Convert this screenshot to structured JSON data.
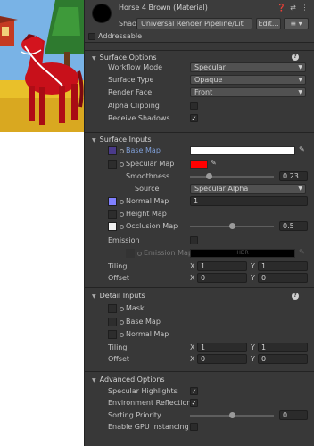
{
  "header": {
    "title": "Horse 4 Brown (Material)",
    "shader_label": "Shader",
    "shader_value": "Universal Render Pipeline/Lit",
    "edit_label": "Edit...",
    "list_label": "≡ ▾",
    "addressable_label": "Addressable"
  },
  "surface_options": {
    "title": "Surface Options",
    "workflow_label": "Workflow Mode",
    "workflow_value": "Specular",
    "surface_type_label": "Surface Type",
    "surface_type_value": "Opaque",
    "render_face_label": "Render Face",
    "render_face_value": "Front",
    "alpha_clipping_label": "Alpha Clipping",
    "receive_shadows_label": "Receive Shadows"
  },
  "surface_inputs": {
    "title": "Surface Inputs",
    "base_map_label": "Base Map",
    "base_map_color": "#ffffff",
    "specular_map_label": "Specular Map",
    "specular_color": "#ff0000",
    "smoothness_label": "Smoothness",
    "smoothness_value": "0.23",
    "smoothness_fraction": 0.23,
    "source_label": "Source",
    "source_value": "Specular Alpha",
    "normal_map_label": "Normal Map",
    "normal_value": "1",
    "height_map_label": "Height Map",
    "occlusion_map_label": "Occlusion Map",
    "occlusion_value": "0.5",
    "occlusion_fraction": 0.5,
    "emission_label": "Emission",
    "emission_map_label": "Emission Map",
    "emission_hdr": "HDR",
    "tiling_label": "Tiling",
    "tiling_x": "1",
    "tiling_y": "1",
    "offset_label": "Offset",
    "offset_x": "0",
    "offset_y": "0",
    "x_label": "X",
    "y_label": "Y"
  },
  "detail_inputs": {
    "title": "Detail Inputs",
    "mask_label": "Mask",
    "base_map_label": "Base Map",
    "normal_map_label": "Normal Map",
    "tiling_label": "Tiling",
    "tiling_x": "1",
    "tiling_y": "1",
    "offset_label": "Offset",
    "offset_x": "0",
    "offset_y": "0",
    "x_label": "X",
    "y_label": "Y"
  },
  "advanced_options": {
    "title": "Advanced Options",
    "specular_highlights_label": "Specular Highlights",
    "env_reflections_label": "Environment Reflections",
    "sorting_priority_label": "Sorting Priority",
    "sorting_priority_value": "0",
    "sorting_priority_fraction": 0.5,
    "gpu_instancing_label": "Enable GPU Instancing"
  }
}
